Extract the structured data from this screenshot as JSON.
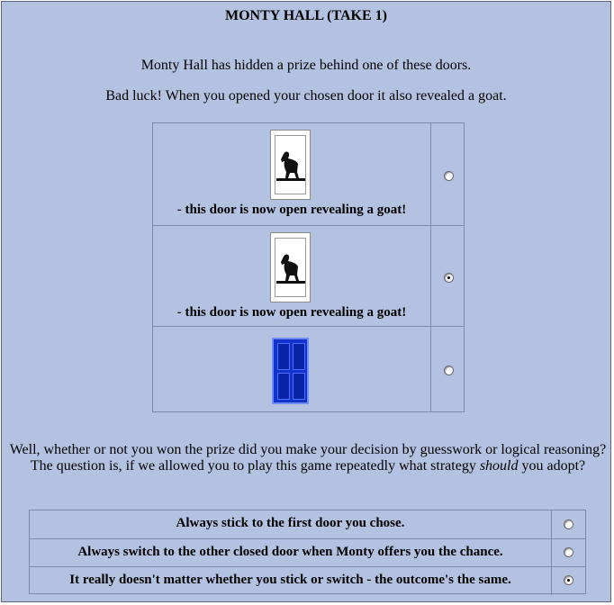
{
  "title": "MONTY HALL (TAKE 1)",
  "intro": {
    "line1": "Monty Hall has hidden a prize behind one of these doors.",
    "line2": "Bad luck! When you opened your chosen door it also revealed a goat."
  },
  "doors": [
    {
      "state": "open-goat",
      "caption": "- this door is now open revealing a goat!",
      "selected": false
    },
    {
      "state": "open-goat",
      "caption": "- this door is now open revealing a goat!",
      "selected": true
    },
    {
      "state": "closed",
      "caption": "",
      "selected": false
    }
  ],
  "question": {
    "part1": "Well, whether or not you won the prize did you make your decision by guesswork or logical reasoning? The question is, if we allowed you to play this game repeatedly what strategy ",
    "emphasis": "should",
    "part2": " you adopt?"
  },
  "options": [
    {
      "label": "Always stick to the first door you chose.",
      "selected": false
    },
    {
      "label": "Always switch to the other closed door when Monty offers you the chance.",
      "selected": false
    },
    {
      "label": "It really doesn't matter whether you stick or switch - the outcome's the same.",
      "selected": true
    }
  ],
  "colors": {
    "background": "#b4c2e1",
    "door_blue": "#1133cc"
  }
}
